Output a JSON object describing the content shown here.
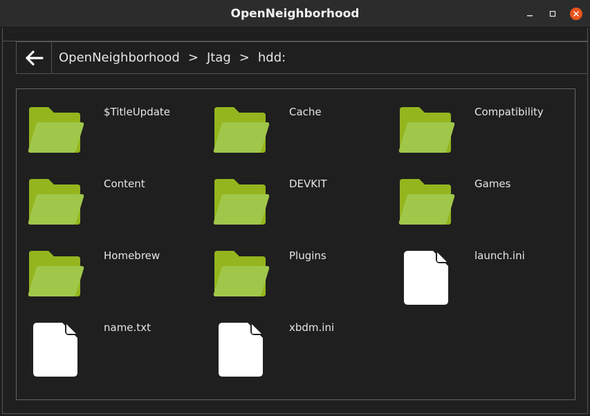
{
  "window": {
    "title": "OpenNeighborhood"
  },
  "navbar": {
    "breadcrumb": [
      "OpenNeighborhood",
      "Jtag",
      "hdd:"
    ],
    "separator": ">"
  },
  "icons": {
    "back": "arrow-left-icon",
    "folder": "folder-icon",
    "file": "file-icon",
    "minimize": "minimize-icon",
    "maximize": "maximize-icon",
    "close": "close-icon"
  },
  "colors": {
    "folder_back": "#95b51e",
    "folder_front": "#a0c74a",
    "file": "#ffffff",
    "close_button": "#e9541e"
  },
  "items": [
    {
      "name": "$TitleUpdate",
      "type": "folder"
    },
    {
      "name": "Cache",
      "type": "folder"
    },
    {
      "name": "Compatibility",
      "type": "folder"
    },
    {
      "name": "Content",
      "type": "folder"
    },
    {
      "name": "DEVKIT",
      "type": "folder"
    },
    {
      "name": "Games",
      "type": "folder"
    },
    {
      "name": "Homebrew",
      "type": "folder"
    },
    {
      "name": "Plugins",
      "type": "folder"
    },
    {
      "name": "launch.ini",
      "type": "file"
    },
    {
      "name": "name.txt",
      "type": "file"
    },
    {
      "name": "xbdm.ini",
      "type": "file"
    }
  ]
}
